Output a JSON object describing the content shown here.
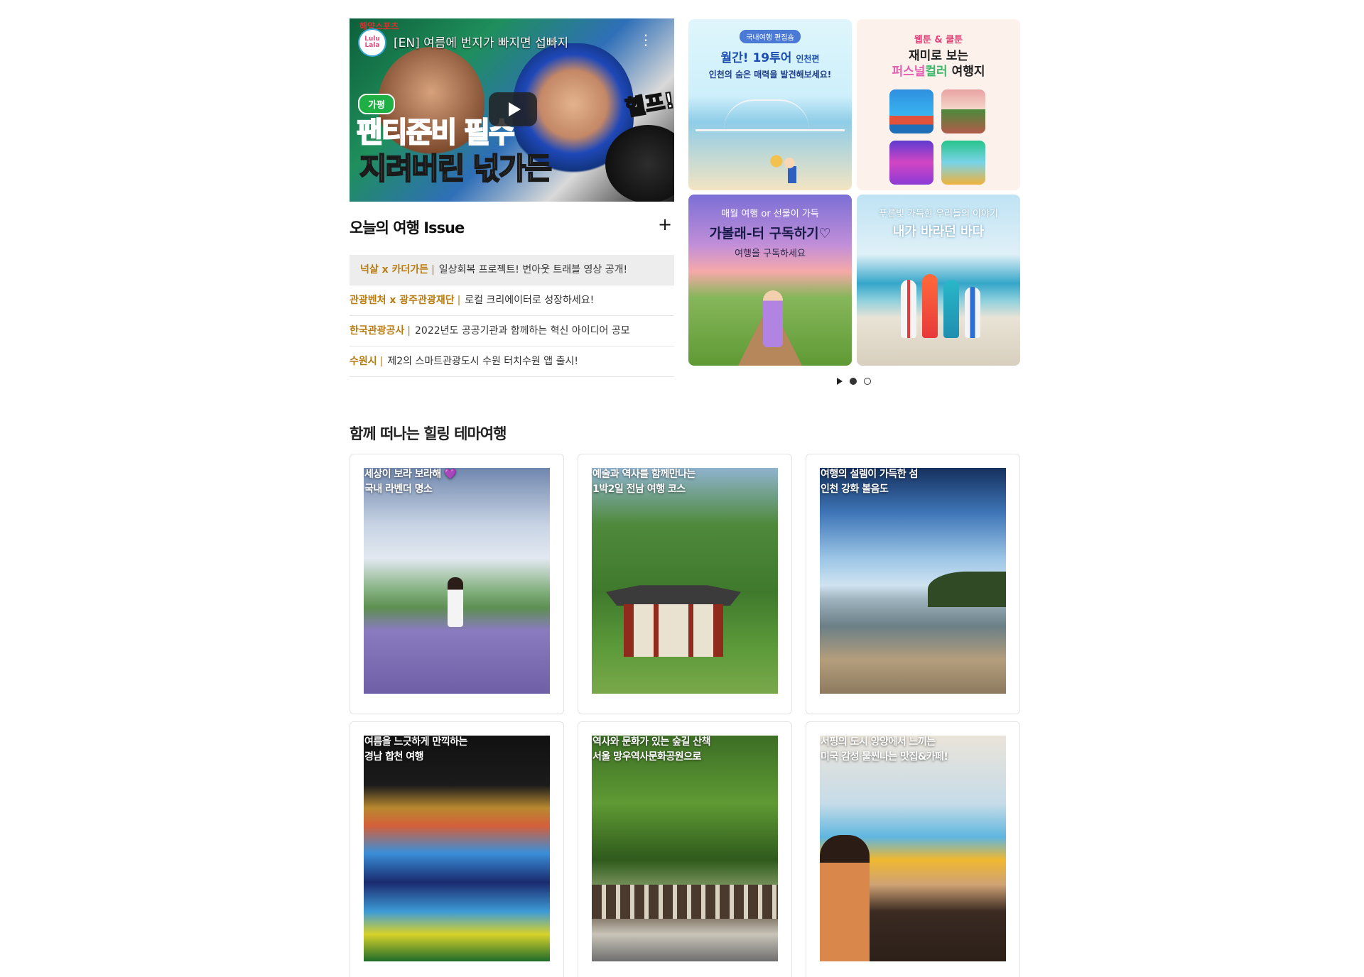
{
  "video": {
    "top_label": "해양스포츠",
    "logo": "Lulu Lala",
    "title": "[EN] 여름에 번지가 빠지면 섭빠지",
    "badge": "가평",
    "caption_line1": "팬티준비 필수",
    "caption_line2": "지려버린 넋가든",
    "caption_side": "헬프!"
  },
  "issues": {
    "heading": "오늘의 여행 Issue",
    "more_symbol": "+",
    "items": [
      {
        "source": "넉살 x 카더가든",
        "text": "일상회복 프로젝트! 번아웃 트래블 영상 공개!"
      },
      {
        "source": "관광벤처 x 광주관광재단",
        "text": "로컬 크리에이터로 성장하세요!"
      },
      {
        "source": "한국관광공사",
        "text": "2022년도 공공기관과 함께하는 혁신 아이디어 공모"
      },
      {
        "source": "수원시",
        "text": "제2의 스마트관광도시 수원 터치수원 앱 출시!"
      }
    ]
  },
  "banners": {
    "b1": {
      "pill": "국내여행 편집숍",
      "title": "월간! 19투어",
      "title_small": "인천편",
      "subtitle": "인천의 숨은 매력을 발견해보세요!"
    },
    "b2": {
      "top": "웹툰 & 쿨툰",
      "line1": "재미로 보는",
      "line2_a": "퍼스널",
      "line2_b": "컬러",
      "line2_c": " 여행지"
    },
    "b3": {
      "top": "매월 여행 or 선물이 가득",
      "title": "가볼래-터 구독하기♡",
      "subtitle": "여행을 구독하세요"
    },
    "b4": {
      "top": "푸른빛 가득한 우리들의 이야기",
      "title": "내가 바라던 바다"
    }
  },
  "theme": {
    "heading": "함께 떠나는 힐링 테마여행",
    "cards": [
      {
        "line1": "세상이 보라 보라해 💜",
        "line2": "국내 라벤더 명소"
      },
      {
        "line1": "예술과 역사를 함께만나는",
        "line2": "1박2일 전남 여행 코스"
      },
      {
        "line1": "여행의 설렘이 가득한 섬",
        "line2": "인천 강화 볼음도"
      },
      {
        "line1": "여름을 느긋하게 만끽하는",
        "line2": "경남 합천 여행"
      },
      {
        "line1": "역사와 문화가 있는 숲길 산책",
        "line2": "서울 망우역사문화공원으로"
      },
      {
        "line1": "서핑의 도시 양양에서 느끼는",
        "line2": "미국 감성 물씬나는 맛집&카페!"
      }
    ]
  },
  "icons": {
    "play": "play-icon",
    "plus": "plus-icon"
  },
  "colors": {
    "issue_source": "#b97b0e",
    "pill": "#4a79d6"
  }
}
